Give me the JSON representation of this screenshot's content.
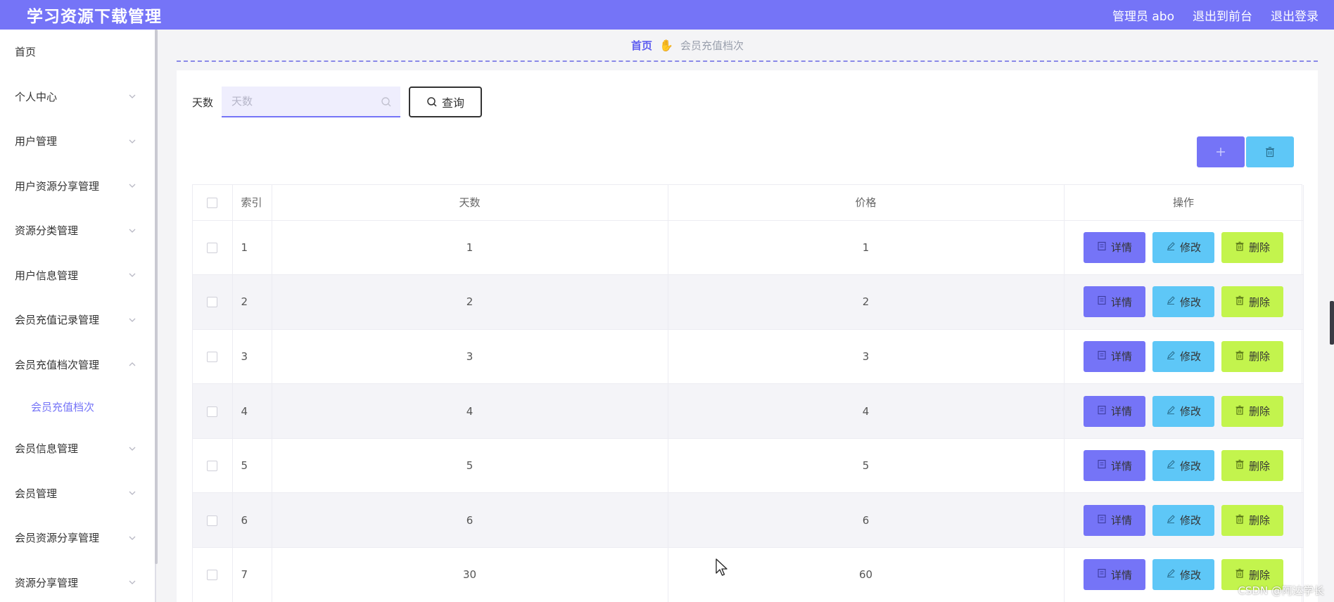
{
  "app": {
    "title": "学习资源下载管理",
    "user_label": "管理员 abo",
    "front_label": "退出到前台",
    "logout_label": "退出登录",
    "accent_color": "#7574f7"
  },
  "sidebar": {
    "items": [
      {
        "label": "首页",
        "chevron": ""
      },
      {
        "label": "个人中心",
        "chevron": "chevron-down-icon"
      },
      {
        "label": "用户管理",
        "chevron": "chevron-down-icon"
      },
      {
        "label": "用户资源分享管理",
        "chevron": "chevron-down-icon"
      },
      {
        "label": "资源分类管理",
        "chevron": "chevron-down-icon"
      },
      {
        "label": "用户信息管理",
        "chevron": "chevron-down-icon"
      },
      {
        "label": "会员充值记录管理",
        "chevron": "chevron-down-icon"
      },
      {
        "label": "会员充值档次管理",
        "chevron": "chevron-up-icon"
      },
      {
        "label": "会员信息管理",
        "chevron": "chevron-down-icon"
      },
      {
        "label": "会员管理",
        "chevron": "chevron-down-icon"
      },
      {
        "label": "会员资源分享管理",
        "chevron": "chevron-down-icon"
      },
      {
        "label": "资源分享管理",
        "chevron": "chevron-down-icon"
      }
    ],
    "active_sub": "会员充值档次"
  },
  "breadcrumb": {
    "home": "首页",
    "current": "会员充值档次"
  },
  "search": {
    "label": "天数",
    "placeholder": "天数",
    "value": "",
    "button_label": "查询"
  },
  "table": {
    "headers": [
      "索引",
      "天数",
      "价格",
      "操作"
    ],
    "rows": [
      {
        "index": "1",
        "days": "1",
        "price": "1"
      },
      {
        "index": "2",
        "days": "2",
        "price": "2"
      },
      {
        "index": "3",
        "days": "3",
        "price": "3"
      },
      {
        "index": "4",
        "days": "4",
        "price": "4"
      },
      {
        "index": "5",
        "days": "5",
        "price": "5"
      },
      {
        "index": "6",
        "days": "6",
        "price": "6"
      },
      {
        "index": "7",
        "days": "30",
        "price": "60"
      }
    ],
    "ops": {
      "detail": "详情",
      "edit": "修改",
      "remove": "删除"
    }
  },
  "watermark": "CSDN @阿达学长"
}
